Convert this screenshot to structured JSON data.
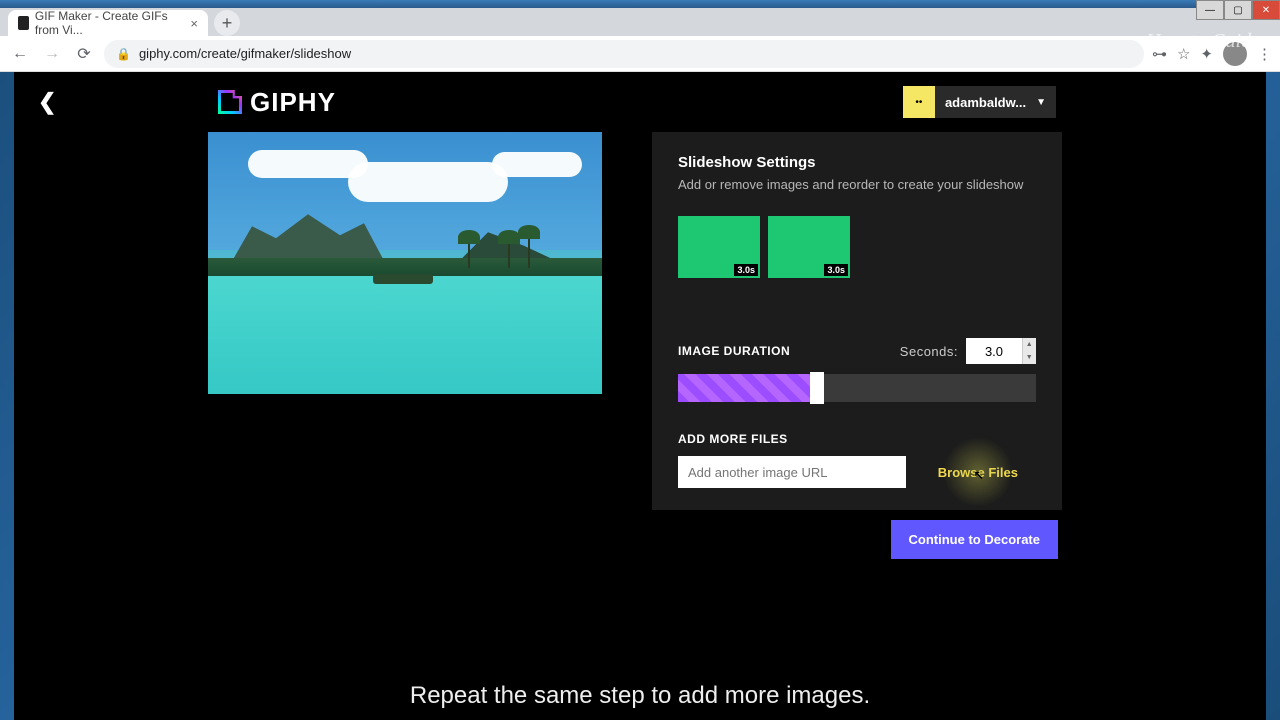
{
  "window": {
    "title": "GIF Maker - Create GIFs from Vid..."
  },
  "browser": {
    "tab_title": "GIF Maker - Create GIFs from Vi...",
    "url": "giphy.com/create/gifmaker/slideshow"
  },
  "header": {
    "logo_text": "GIPHY",
    "user_name": "adambaldw..."
  },
  "panel": {
    "title": "Slideshow Settings",
    "subtitle": "Add or remove images and reorder to create your slideshow",
    "thumbs": [
      {
        "duration_label": "3.0s"
      },
      {
        "duration_label": "3.0s"
      }
    ],
    "duration_label": "IMAGE DURATION",
    "seconds_label": "Seconds:",
    "seconds_value": "3.0",
    "add_files_label": "ADD MORE FILES",
    "url_placeholder": "Add another image URL",
    "browse_label": "Browse Files"
  },
  "continue_label": "Continue to Decorate",
  "caption": "Repeat the same step to add more images.",
  "watermark": "How-to Guide"
}
